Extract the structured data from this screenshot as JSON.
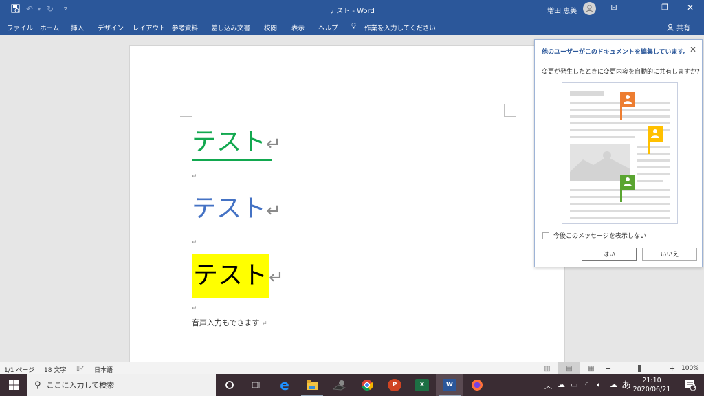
{
  "window": {
    "title": "テスト  -  Word",
    "user_name": "増田 恵美"
  },
  "quick_access": {
    "save_icon": "save-autosave-icon",
    "undo_icon": "undo-icon",
    "redo_icon": "redo-icon",
    "customize_icon": "customize-dropdown-icon"
  },
  "ribbon": {
    "tabs": [
      "ファイル",
      "ホーム",
      "挿入",
      "デザイン",
      "レイアウト",
      "参考資料",
      "差し込み文書",
      "校閲",
      "表示",
      "ヘルプ"
    ],
    "tell_me": "作業を入力してください",
    "share": "共有"
  },
  "document": {
    "lines": [
      {
        "text": "テスト",
        "style": "green-underline",
        "color": "#12a84f"
      },
      {
        "text": "テスト",
        "style": "blue",
        "color": "#4472c4"
      },
      {
        "text": "テスト",
        "style": "yellow-highlight",
        "color": "#000000",
        "highlight": "#ffff00"
      }
    ],
    "return_mark": "↵",
    "voice_line": "音声入力もできます"
  },
  "popup": {
    "title": "他のユーザーがこのドキュメントを編集しています。",
    "question": "変更が発生したときに変更内容を自動的に共有しますか?",
    "checkbox_label": "今後このメッセージを表示しない",
    "checkbox_checked": false,
    "yes": "はい",
    "no": "いいえ",
    "flag_colors": [
      "#ed7d31",
      "#ffc000",
      "#5aa531"
    ]
  },
  "statusbar": {
    "page": "1/1 ページ",
    "words": "18 文字",
    "language": "日本語",
    "zoom": "100%",
    "zoom_minus": "−",
    "zoom_plus": "+"
  },
  "taskbar": {
    "search_placeholder": "ここに入力して検索",
    "time": "21:10",
    "date": "2020/06/21",
    "ime": "あ",
    "notification_count": "1",
    "apps": [
      "cortana",
      "task-view",
      "edge",
      "file-explorer",
      "unknown-app",
      "chrome",
      "powerpoint",
      "excel",
      "word",
      "firefox"
    ]
  }
}
